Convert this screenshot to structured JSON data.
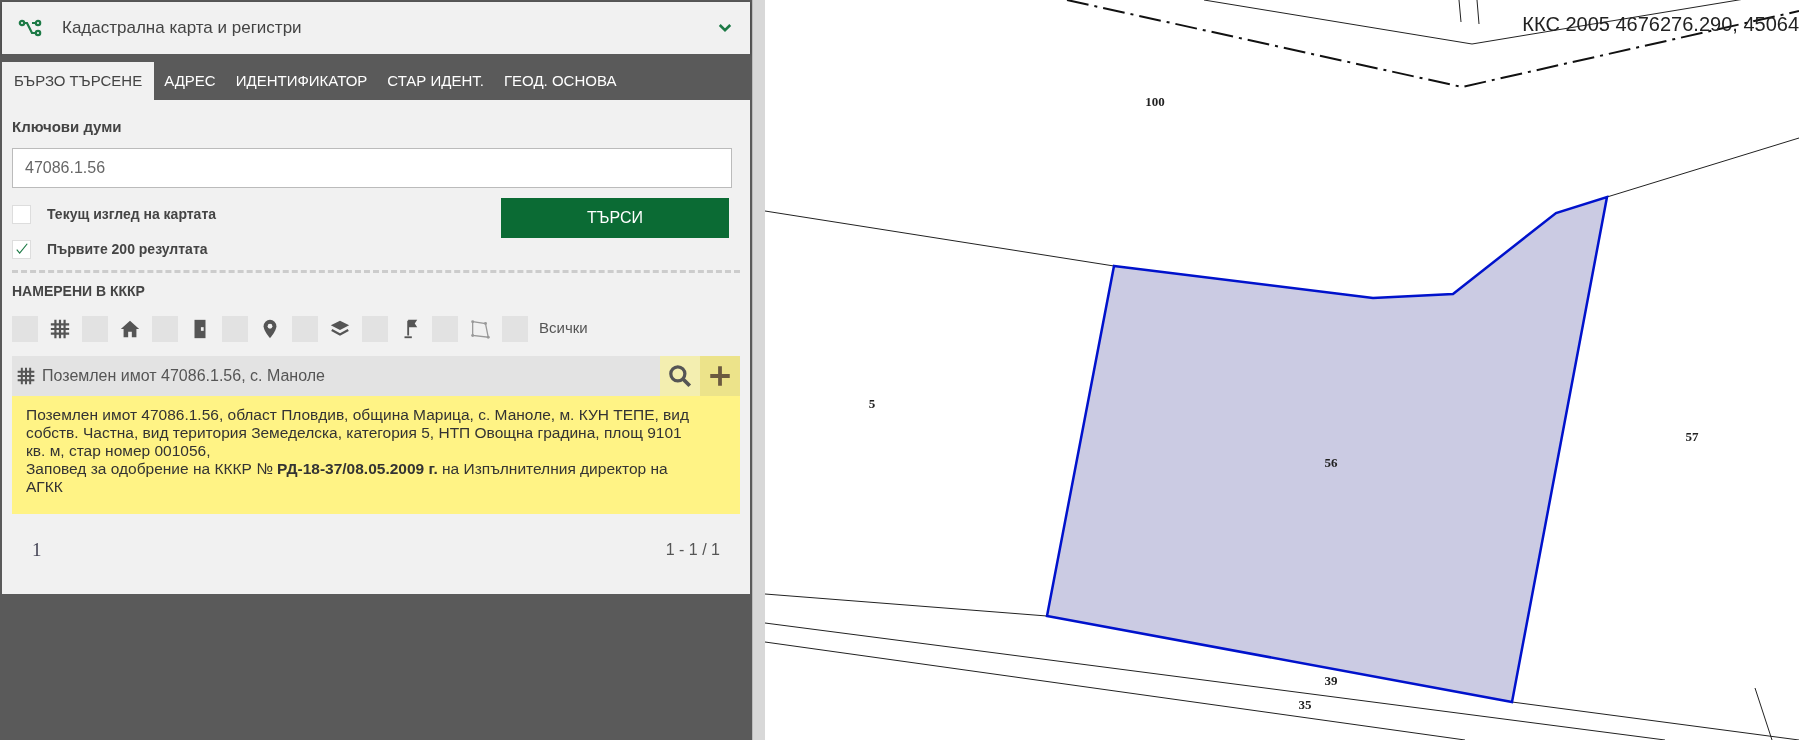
{
  "panel": {
    "title": "Кадастрална карта и регистри"
  },
  "tabs": [
    {
      "label": "БЪРЗО ТЪРСЕНЕ",
      "selected": true
    },
    {
      "label": "АДРЕС",
      "selected": false
    },
    {
      "label": "ИДЕНТИФИКАТОР",
      "selected": false
    },
    {
      "label": "СТАР ИДЕНТ.",
      "selected": false
    },
    {
      "label": "ГЕОД. ОСНОВА",
      "selected": false
    }
  ],
  "search": {
    "label": "Ключови думи",
    "value": "47086.1.56",
    "options": [
      {
        "label": "Текущ изглед на картата",
        "checked": false
      },
      {
        "label": "Първите 200 резултата",
        "checked": true
      }
    ],
    "button": "ТЪРСИ"
  },
  "results": {
    "title": "НАМЕРЕНИ В КККР",
    "filters": [
      {
        "kind": "parcel",
        "checked": false
      },
      {
        "kind": "building",
        "checked": false
      },
      {
        "kind": "unit",
        "checked": false
      },
      {
        "kind": "point",
        "checked": false
      },
      {
        "kind": "layers",
        "checked": false
      },
      {
        "kind": "flag",
        "checked": false
      },
      {
        "kind": "polygon",
        "checked": false
      },
      {
        "kind": "all",
        "label": "Всички",
        "checked": false
      }
    ],
    "items": [
      {
        "kind": "parcel",
        "title": "Поземлен имот 47086.1.56, с. Маноле",
        "detail": "Поземлен имот 47086.1.56, област Пловдив, община Марица, с. Маноле, м. КУН ТЕПЕ, вид собств. Частна, вид територия Земеделска, категория 5, НТП Овощна градина, площ 9101 кв. м, стар номер 001056,\nЗаповед за одобрение на КККР № **РД-18-37/08.05.2009 г.** на Изпълнителния директор на АГКК"
      }
    ],
    "pages": [
      {
        "label": "1",
        "selected": true
      }
    ],
    "range": "1 - 1 / 1"
  },
  "map": {
    "coordinates": "ККС 2005 4676276.290, 45064",
    "labels": [
      {
        "text": "100"
      },
      {
        "text": "5"
      },
      {
        "text": "56"
      },
      {
        "text": "57"
      },
      {
        "text": "39"
      },
      {
        "text": "35"
      }
    ]
  }
}
